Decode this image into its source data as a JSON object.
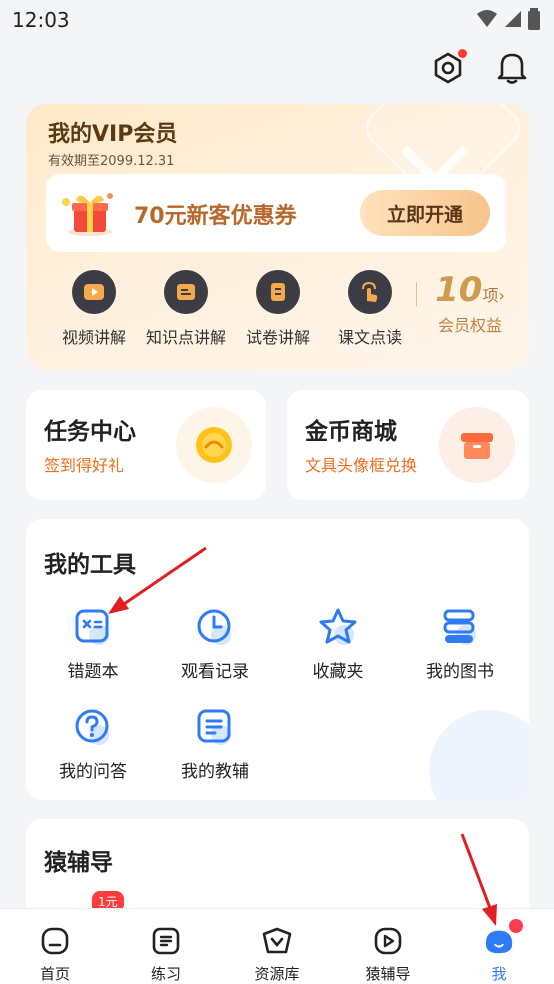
{
  "status": {
    "time": "12:03"
  },
  "vip": {
    "title": "我的VIP会员",
    "expire": "有效期至2099.12.31",
    "coupon_text": "70元新客优惠券",
    "coupon_button": "立即开通",
    "features": [
      {
        "label": "视频讲解",
        "icon": "play-icon"
      },
      {
        "label": "知识点讲解",
        "icon": "card-icon"
      },
      {
        "label": "试卷讲解",
        "icon": "paper-icon"
      },
      {
        "label": "课文点读",
        "icon": "tap-icon"
      }
    ],
    "benefits_count": "10",
    "benefits_unit": "项›",
    "benefits_label": "会员权益"
  },
  "task_center": {
    "title": "任务中心",
    "subtitle": "签到得好礼"
  },
  "coin_mall": {
    "title": "金币商城",
    "subtitle": "文具头像框兑换"
  },
  "tools": {
    "title": "我的工具",
    "items": [
      {
        "label": "错题本",
        "icon": "calculator-icon"
      },
      {
        "label": "观看记录",
        "icon": "clock-icon"
      },
      {
        "label": "收藏夹",
        "icon": "star-icon"
      },
      {
        "label": "我的图书",
        "icon": "books-icon"
      },
      {
        "label": "我的问答",
        "icon": "question-icon"
      },
      {
        "label": "我的教辅",
        "icon": "book-icon"
      }
    ]
  },
  "yuanfudao": {
    "title": "猿辅导",
    "price_tag": "1元"
  },
  "nav": {
    "items": [
      {
        "label": "首页",
        "icon": "home-icon"
      },
      {
        "label": "练习",
        "icon": "practice-icon"
      },
      {
        "label": "资源库",
        "icon": "resource-icon"
      },
      {
        "label": "猿辅导",
        "icon": "video-icon"
      },
      {
        "label": "我",
        "icon": "me-avatar-icon"
      }
    ],
    "active": "我"
  },
  "colors": {
    "accent": "#2f7bf5",
    "orange": "#ea6f1f",
    "vip_gold": "#d29a4c",
    "badge_red": "#ff3b30"
  }
}
